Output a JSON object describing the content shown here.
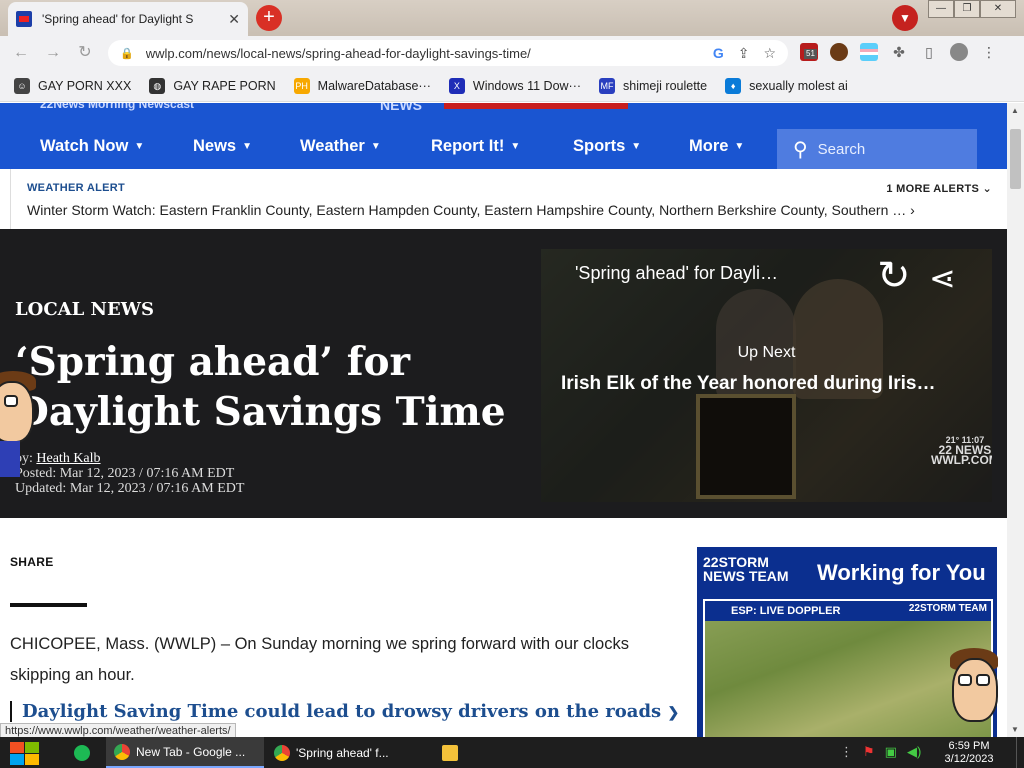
{
  "browser": {
    "tab_title": "'Spring ahead' for Daylight S",
    "tab_close": "✕",
    "new_tab": "+",
    "url": "wwlp.com/news/local-news/spring-ahead-for-daylight-savings-time/",
    "extension_badge": "51",
    "bookmarks": [
      {
        "label": "GAY PORN XXX",
        "color": "#444"
      },
      {
        "label": "GAY RAPE PORN",
        "color": "#333"
      },
      {
        "label": "MalwareDatabase···",
        "color": "#f7a800"
      },
      {
        "label": "Windows 11 Dow···",
        "color": "#1f2db7"
      },
      {
        "label": "shimeji roulette",
        "color": "#2a3fbf"
      },
      {
        "label": "sexually molest ai",
        "color": "#0a7bd8"
      }
    ]
  },
  "site": {
    "brand_left": "22News Morning Newscast",
    "brand_news": "NEWS",
    "nav": [
      {
        "label": "Watch Now",
        "caret": "▼"
      },
      {
        "label": "News",
        "caret": "▼"
      },
      {
        "label": "Weather",
        "caret": "▼"
      },
      {
        "label": "Report It!",
        "caret": "▼"
      },
      {
        "label": "Sports",
        "caret": "▼"
      },
      {
        "label": "More",
        "caret": "▼"
      }
    ],
    "search_placeholder": "Search"
  },
  "alert": {
    "label": "WEATHER ALERT",
    "more": "1 MORE ALERTS",
    "text": "Winter Storm Watch: Eastern Franklin County, Eastern Hampden County, Eastern Hampshire County, Northern Berkshire County, Southern …"
  },
  "article": {
    "section": "LOCAL NEWS",
    "headline": "‘Spring ahead’ for Daylight Savings Time",
    "byline_prefix": "by: ",
    "author": "Heath Kalb",
    "posted": "Posted: Mar 12, 2023 / 07:16 AM EDT",
    "updated": "Updated: Mar 12, 2023 / 07:16 AM EDT",
    "share_label": "SHARE",
    "lead": "CHICOPEE, Mass. (WWLP) – On Sunday morning we spring forward with our clocks skipping an hour.",
    "related_link": "Daylight Saving Time could lead to drowsy drivers on the roads"
  },
  "video": {
    "title": "'Spring ahead' for Dayli…",
    "up_next": "Up Next",
    "next_title": "Irish Elk of the Year honored during Iris…",
    "watermark_time": "21° 11:07",
    "watermark_brand": "22 NEWS WWLP.COM"
  },
  "ad": {
    "logo_top": "22STORM",
    "logo_bottom": "NEWS TEAM",
    "title": "Working for You",
    "map_label": "ESP: LIVE DOPPLER",
    "map_brand": "22STORM TEAM"
  },
  "status_url": "https://www.wwlp.com/weather/weather-alerts/",
  "taskbar": {
    "apps": [
      {
        "label": "New Tab - Google ..."
      },
      {
        "label": "'Spring ahead' f..."
      }
    ],
    "time": "6:59 PM",
    "date": "3/12/2023"
  },
  "colors": {
    "site_blue": "#1a55d1",
    "hero_bg": "#1c1c1e",
    "link_blue": "#1d4e8f"
  }
}
